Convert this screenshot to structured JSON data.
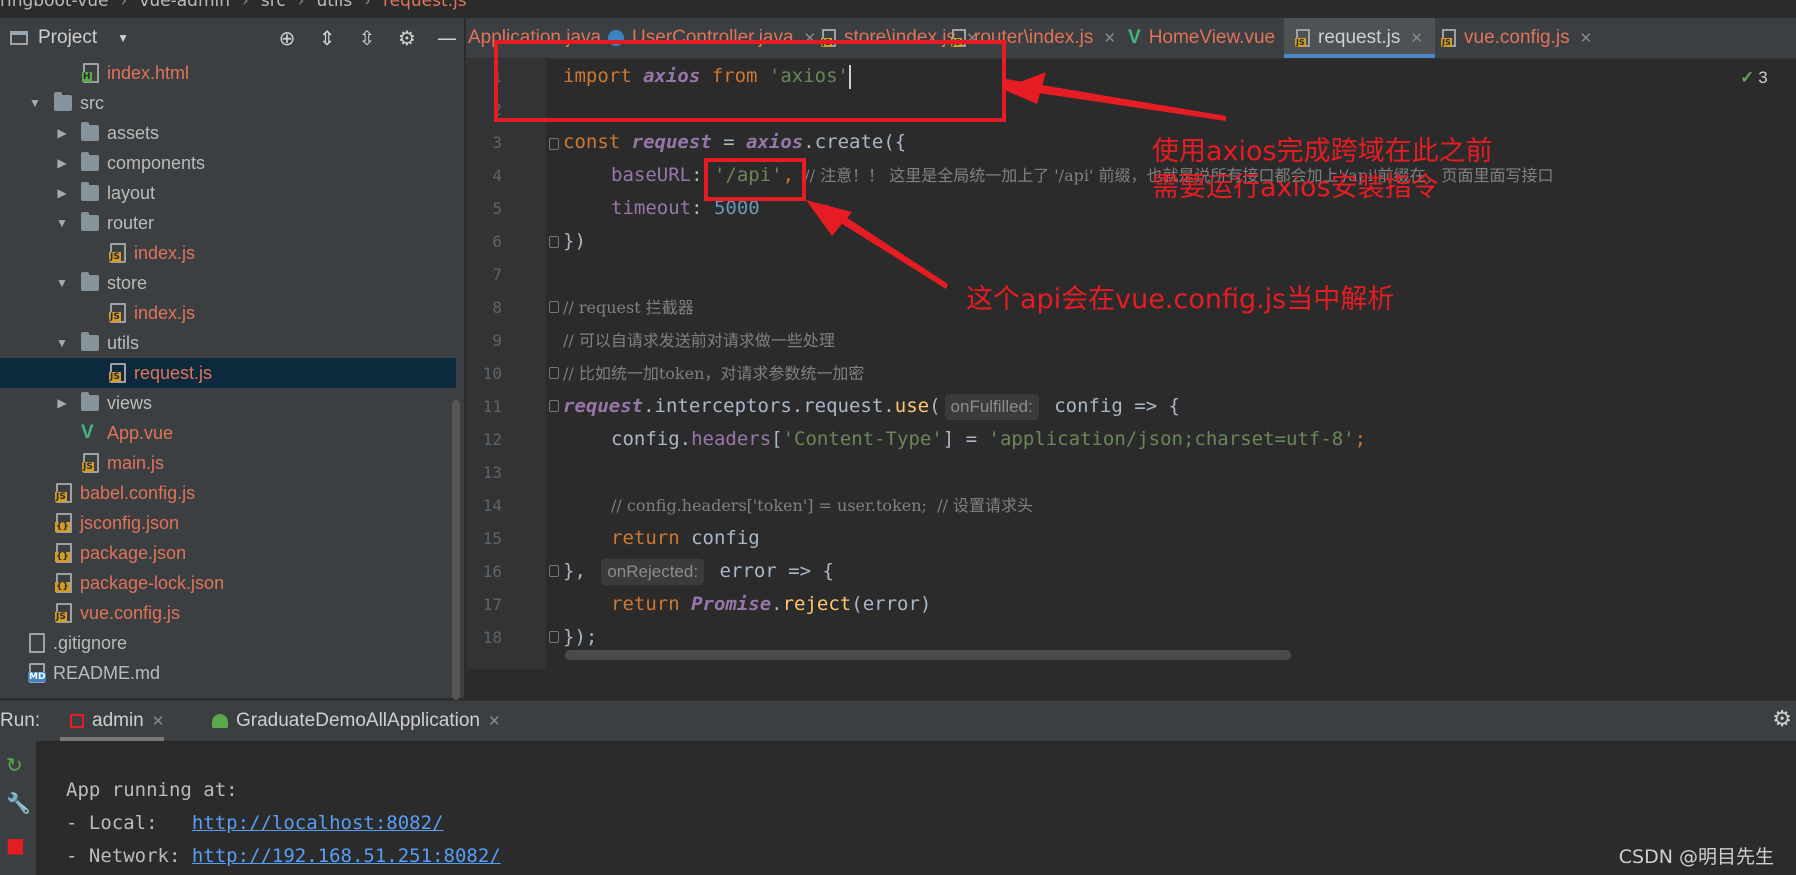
{
  "breadcrumb": [
    "ringboot-vue",
    "vue-admin",
    "src",
    "utils",
    "request.js"
  ],
  "project_panel": {
    "title": "Project",
    "items": [
      {
        "label": "index.html",
        "type": "file-html",
        "depth": 3
      },
      {
        "label": "src",
        "type": "folder-open",
        "depth": 2
      },
      {
        "label": "assets",
        "type": "folder",
        "depth": 3
      },
      {
        "label": "components",
        "type": "folder",
        "depth": 3
      },
      {
        "label": "layout",
        "type": "folder",
        "depth": 3
      },
      {
        "label": "router",
        "type": "folder-open",
        "depth": 3
      },
      {
        "label": "index.js",
        "type": "file-js",
        "depth": 4
      },
      {
        "label": "store",
        "type": "folder-open",
        "depth": 3
      },
      {
        "label": "index.js",
        "type": "file-js",
        "depth": 4
      },
      {
        "label": "utils",
        "type": "folder-open",
        "depth": 3
      },
      {
        "label": "request.js",
        "type": "file-js",
        "depth": 4,
        "selected": true
      },
      {
        "label": "views",
        "type": "folder",
        "depth": 3
      },
      {
        "label": "App.vue",
        "type": "file-vue",
        "depth": 3
      },
      {
        "label": "main.js",
        "type": "file-js",
        "depth": 3
      },
      {
        "label": "babel.config.js",
        "type": "file-js",
        "depth": 2
      },
      {
        "label": "jsconfig.json",
        "type": "file-json",
        "depth": 2
      },
      {
        "label": "package.json",
        "type": "file-json",
        "depth": 2
      },
      {
        "label": "package-lock.json",
        "type": "file-json",
        "depth": 2
      },
      {
        "label": "vue.config.js",
        "type": "file-js",
        "depth": 2
      },
      {
        "label": ".gitignore",
        "type": "file-plain",
        "depth": 1
      },
      {
        "label": "README.md",
        "type": "file-md",
        "depth": 1
      }
    ]
  },
  "editor_tabs": [
    {
      "label": "Application.java",
      "icon": "java"
    },
    {
      "label": "UserController.java",
      "icon": "class"
    },
    {
      "label": "store\\index.js",
      "icon": "js"
    },
    {
      "label": "router\\index.js",
      "icon": "js"
    },
    {
      "label": "HomeView.vue",
      "icon": "vue"
    },
    {
      "label": "request.js",
      "icon": "js",
      "active": true
    },
    {
      "label": "vue.config.js",
      "icon": "js"
    }
  ],
  "inspection_count": "3",
  "code": {
    "line_numbers": [
      "1",
      "2",
      "3",
      "4",
      "5",
      "6",
      "7",
      "8",
      "9",
      "10",
      "11",
      "12",
      "13",
      "14",
      "15",
      "16",
      "17",
      "18"
    ],
    "l1": {
      "kw": "import ",
      "name": "axios",
      "from": " from ",
      "str": "'axios'"
    },
    "l3": {
      "kw": "const ",
      "name": "request",
      "eq": " = ",
      "obj": "axios",
      "call": ".create({"
    },
    "l4": {
      "key": "baseURL",
      "colon": ": ",
      "str": "'/api'",
      "comma": ",",
      "comment": "  // 注意！！ 这里是全局统一加上了 '/api' 前缀，也就是说所有接口都会加上'/api'前缀在，页面里面写接口"
    },
    "l5": {
      "key": "timeout",
      "colon": ": ",
      "num": "5000"
    },
    "l6": "})",
    "l8": "// request 拦截器",
    "l9": "// 可以自请求发送前对请求做一些处理",
    "l10": "// 比如统一加token，对请求参数统一加密",
    "l11": {
      "name": "request",
      "chain": ".interceptors.request.",
      "fn": "use",
      "paren": "(",
      "hint": "onFulfilled:",
      "rest": " config => {"
    },
    "l12": {
      "a": "config.",
      "prop": "headers",
      "b": "[",
      "str1": "'Content-Type'",
      "c": "] = ",
      "str2": "'application/json;charset=utf-8'",
      "d": ";"
    },
    "l14": "// config.headers['token'] = user.token;  // 设置请求头",
    "l15": {
      "kw": "return ",
      "rest": "config"
    },
    "l16": {
      "a": "}, ",
      "hint": "onRejected:",
      "rest": " error => {"
    },
    "l17": {
      "kw": "return ",
      "cls": "Promise",
      "dot": ".",
      "fn": "reject",
      "rest": "(error)"
    },
    "l18": "});"
  },
  "annotations": {
    "note1_line1": "使用axios完成跨域在此之前",
    "note1_line2": "需要运行axios安装指令",
    "note2": "这个api会在vue.config.js当中解析"
  },
  "run_panel": {
    "label": "Run:",
    "tabs": [
      "admin",
      "GraduateDemoAllApplication"
    ],
    "console": {
      "line1": "App running at:",
      "local_label": "- Local:   ",
      "local_url": "http://localhost:8082/",
      "network_label": "- Network: ",
      "network_url": "http://192.168.51.251:8082/"
    }
  },
  "watermark": "CSDN @明目先生",
  "colors": {
    "annotation_red": "#e51c23",
    "accent_blue": "#4a88c7",
    "selection": "#0d293e"
  }
}
